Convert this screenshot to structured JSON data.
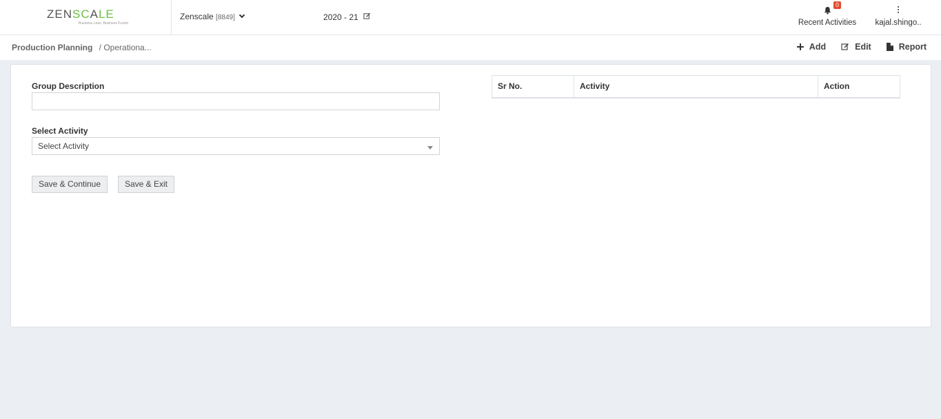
{
  "brand": {
    "logo_main_1": "ZEN",
    "logo_main_2": "SC",
    "logo_main_3": "A",
    "logo_main_4": "LE",
    "logo_tagline": "Business Lean, Business Fusion"
  },
  "header": {
    "company_name": "Zenscale",
    "company_code": "[8849]",
    "financial_year": "2020 - 21",
    "notifications_count": "0",
    "recent_activities_label": "Recent Activities",
    "user_name": "kajal.shingo.."
  },
  "breadcrumb": {
    "module": "Production Planning",
    "page": "/ Operationa..."
  },
  "toolbar": {
    "add_label": "Add",
    "edit_label": "Edit",
    "report_label": "Report"
  },
  "form": {
    "group_description_label": "Group Description",
    "group_description_value": "",
    "select_activity_label": "Select Activity",
    "select_activity_value": "Select Activity",
    "save_continue_label": "Save & Continue",
    "save_exit_label": "Save & Exit"
  },
  "activity_table": {
    "columns": [
      "Sr No.",
      "Activity",
      "Action"
    ],
    "rows": []
  },
  "colors": {
    "accent_green": "#6bbf3c",
    "badge_red": "#e04b2a",
    "page_background": "#ebeef2"
  }
}
